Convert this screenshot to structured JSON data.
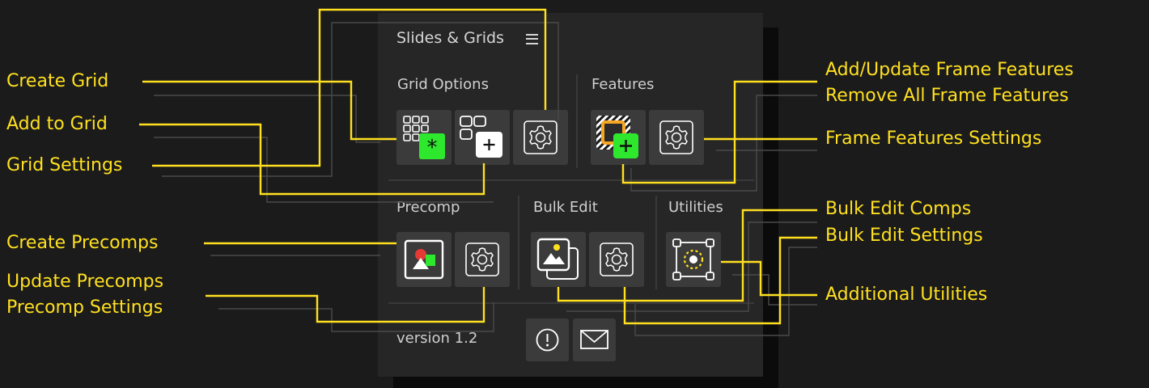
{
  "panel": {
    "title": "Slides & Grids",
    "sections": {
      "grid_options": "Grid Options",
      "features": "Features",
      "precomp": "Precomp",
      "bulk_edit": "Bulk Edit",
      "utilities": "Utilities"
    },
    "version": "version 1.2"
  },
  "icons": {
    "menu": "hamburger-menu-icon",
    "create_grid": "grid-asterisk-icon",
    "add_to_grid": "grid-plus-icon",
    "settings": "gear-icon",
    "frame_features": "hatched-frame-plus-icon",
    "precomp": "image-shapes-icon",
    "bulk_edit": "stacked-images-icon",
    "utilities": "target-nodes-icon",
    "info": "exclamation-circle-icon",
    "mail": "envelope-icon"
  },
  "annotations": {
    "create_grid": "Create Grid",
    "add_to_grid": "Add to Grid",
    "grid_settings": "Grid Settings",
    "create_precomps": "Create Precomps",
    "update_precomps": "Update Precomps",
    "precomp_settings": "Precomp Settings",
    "add_update_frame_features": "Add/Update Frame Features",
    "remove_all_frame_features": "Remove All Frame Features",
    "frame_features_settings": "Frame Features Settings",
    "bulk_edit_comps": "Bulk Edit Comps",
    "bulk_edit_settings": "Bulk Edit Settings",
    "additional_utilities": "Additional Utilities"
  },
  "colors": {
    "background": "#1b1b1b",
    "panel": "#262626",
    "button": "#3b3b3b",
    "annotation": "#ffe020",
    "green_badge": "#2ee82e",
    "orange_frame": "#f5a623",
    "red_shape": "#e53935"
  }
}
